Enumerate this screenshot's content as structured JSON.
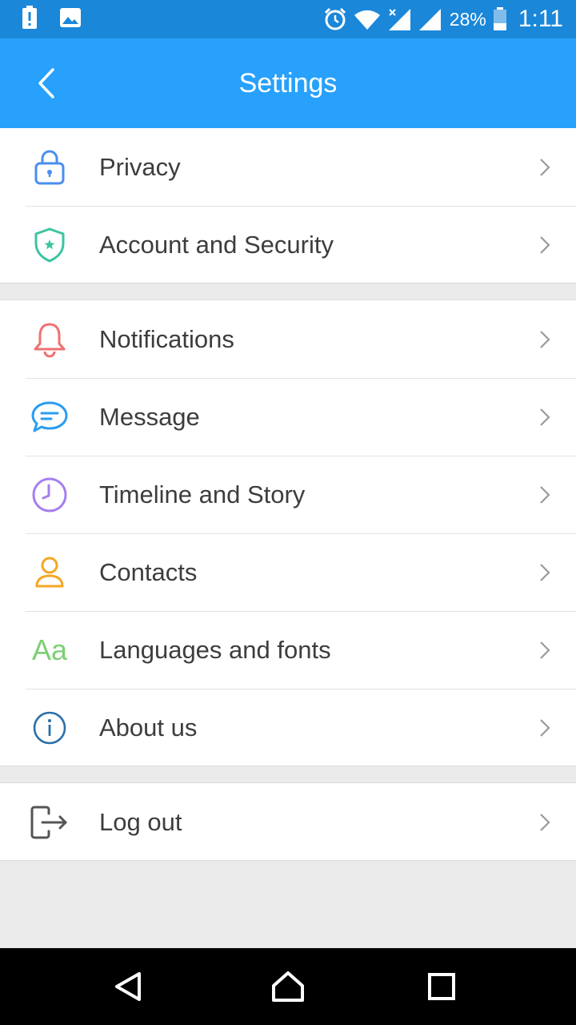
{
  "status_bar": {
    "battery_percent": "28%",
    "time": "1:11"
  },
  "header": {
    "title": "Settings"
  },
  "sections": [
    {
      "items": [
        {
          "label": "Privacy",
          "icon": "lock-icon",
          "color": "#4a8ef0"
        },
        {
          "label": "Account and Security",
          "icon": "shield-icon",
          "color": "#3cc4a0"
        }
      ]
    },
    {
      "items": [
        {
          "label": "Notifications",
          "icon": "bell-icon",
          "color": "#f07070"
        },
        {
          "label": "Message",
          "icon": "chat-bubble-icon",
          "color": "#2b9cf0"
        },
        {
          "label": "Timeline and Story",
          "icon": "clock-icon",
          "color": "#a57ff0"
        },
        {
          "label": "Contacts",
          "icon": "person-icon",
          "color": "#f5a623"
        },
        {
          "label": "Languages and fonts",
          "icon": "font-icon",
          "icon_text": "Aa",
          "color": "#7dcf74"
        },
        {
          "label": "About us",
          "icon": "info-icon",
          "color": "#2a6fa8"
        }
      ]
    },
    {
      "items": [
        {
          "label": "Log out",
          "icon": "logout-icon",
          "color": "#555555"
        }
      ]
    }
  ],
  "colors": {
    "status_bar": "#1a87d9",
    "app_bar": "#27a1fb",
    "background": "#ebebeb"
  }
}
